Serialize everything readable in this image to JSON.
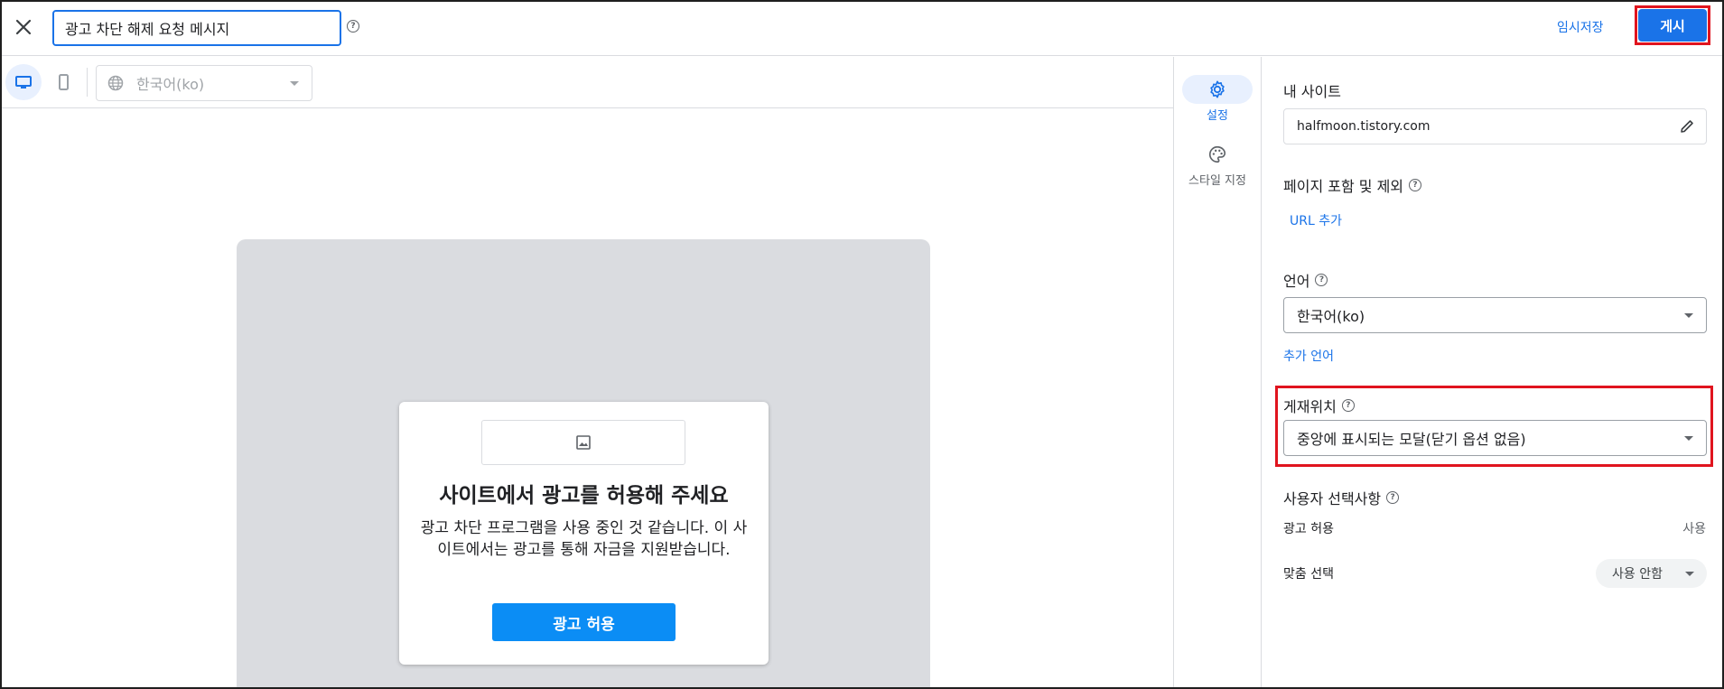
{
  "header": {
    "title_value": "광고 차단 해제 요청 메시지",
    "save_draft_label": "임시저장",
    "publish_label": "게시",
    "help_glyph": "?"
  },
  "preview_toolbar": {
    "language_value": "한국어(ko)"
  },
  "preview_message": {
    "heading": "사이트에서 광고를 허용해 주세요",
    "body": "광고 차단 프로그램을 사용 중인 것 같습니다. 이 사이트에서는 광고를 통해 자금을 지원받습니다.",
    "allow_button_label": "광고 허용"
  },
  "sidenav": {
    "items": [
      {
        "label": "설정",
        "icon": "gear-icon",
        "active": true
      },
      {
        "label": "스타일 지정",
        "icon": "palette-icon",
        "active": false
      }
    ]
  },
  "settings": {
    "my_site": {
      "label": "내 사이트",
      "value": "halfmoon.tistory.com"
    },
    "page_include": {
      "label": "페이지 포함 및 제외",
      "add_url_label": "URL 추가"
    },
    "language": {
      "label": "언어",
      "value": "한국어(ko)",
      "add_language_label": "추가 언어"
    },
    "placement": {
      "label": "게재위치",
      "value": "중앙에 표시되는 모달(닫기 옵션 없음)"
    },
    "user_choices": {
      "label": "사용자 선택사항",
      "rows": [
        {
          "label": "광고 허용",
          "value": "사용"
        },
        {
          "label": "맞춤 선택",
          "value": "사용 안함"
        }
      ]
    }
  },
  "colors": {
    "accent": "#1a73e8",
    "highlight_outline": "#e0141e",
    "allow_button": "#0b8df5"
  }
}
